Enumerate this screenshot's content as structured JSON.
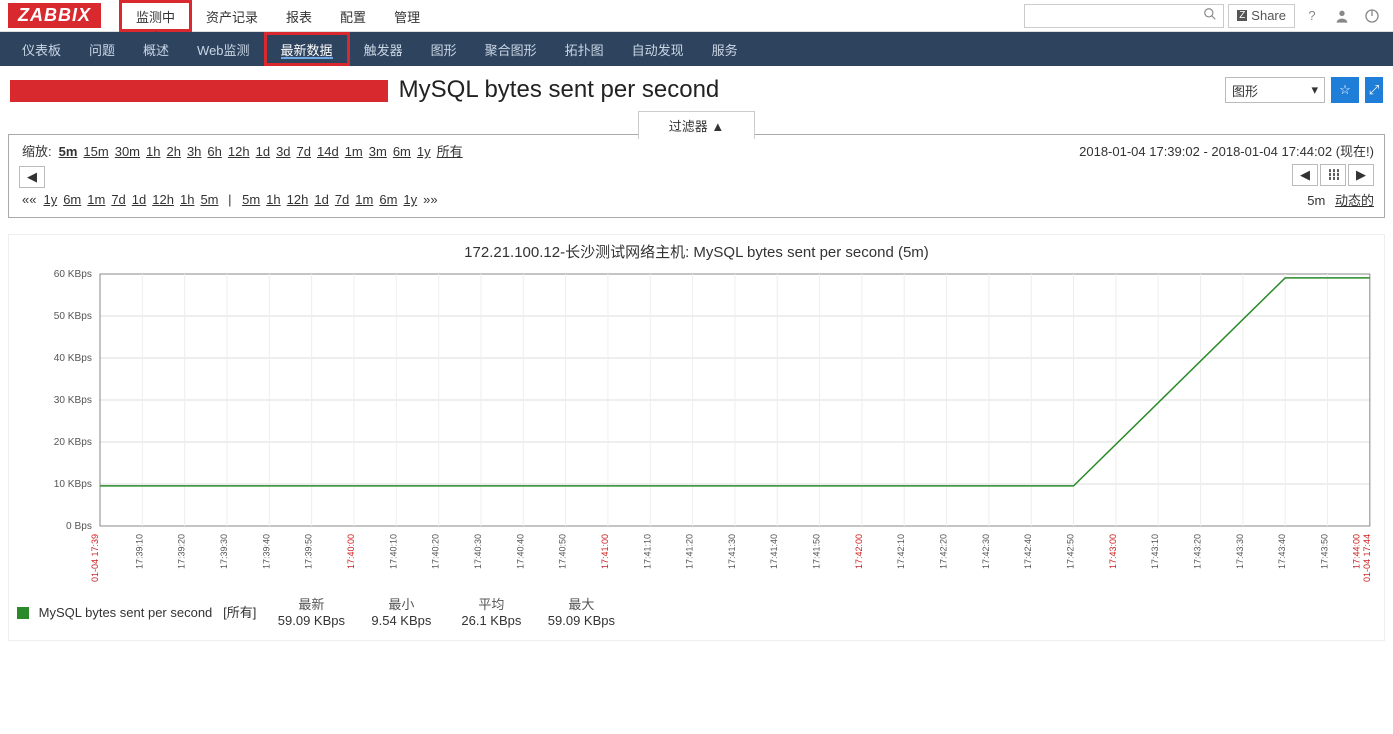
{
  "logo": "ZABBIX",
  "topnav": {
    "items": [
      "监测中",
      "资产记录",
      "报表",
      "配置",
      "管理"
    ],
    "active_index": 0,
    "highlight_index": 0
  },
  "topright": {
    "share": "Share"
  },
  "subnav": {
    "items": [
      "仪表板",
      "问题",
      "概述",
      "Web监测",
      "最新数据",
      "触发器",
      "图形",
      "聚合图形",
      "拓扑图",
      "自动发现",
      "服务"
    ],
    "active_index": 4,
    "highlight_index": 4
  },
  "page_title_suffix": " MySQL bytes sent per second",
  "view_select": "图形",
  "filter_toggle": "过滤器 ▲",
  "zoom": {
    "label": "缩放:",
    "options": [
      "5m",
      "15m",
      "30m",
      "1h",
      "2h",
      "3h",
      "6h",
      "12h",
      "1d",
      "3d",
      "7d",
      "14d",
      "1m",
      "3m",
      "6m",
      "1y",
      "所有"
    ],
    "active": "5m"
  },
  "time_range": "2018-01-04 17:39:02 - 2018-01-04 17:44:02 (现在!)",
  "hist_left": {
    "prefix": "««",
    "groups": [
      [
        "1y",
        "6m",
        "1m",
        "7d",
        "1d",
        "12h",
        "1h",
        "5m"
      ],
      [
        "5m",
        "1h",
        "12h",
        "1d",
        "7d",
        "1m",
        "6m",
        "1y"
      ]
    ],
    "suffix": "»»"
  },
  "right_meta": {
    "val": "5m",
    "mode": "动态的"
  },
  "chart_data": {
    "type": "line",
    "title": "172.21.100.12-长沙测试网络主机: MySQL bytes sent per second (5m)",
    "ylabel_unit": "Bps",
    "y_ticks": [
      0,
      10,
      20,
      30,
      40,
      50,
      60
    ],
    "y_tick_labels": [
      "0 Bps",
      "10 KBps",
      "20 KBps",
      "30 KBps",
      "40 KBps",
      "50 KBps",
      "60 KBps"
    ],
    "x_start_label": "01-04 17:39",
    "x_end_label_top": "17:44:00",
    "x_end_label_bottom": "01-04 17:44",
    "x_ticks": [
      "17:39:10",
      "17:39:20",
      "17:39:30",
      "17:39:40",
      "17:39:50",
      "17:40:00",
      "17:40:10",
      "17:40:20",
      "17:40:30",
      "17:40:40",
      "17:40:50",
      "17:41:00",
      "17:41:10",
      "17:41:20",
      "17:41:30",
      "17:41:40",
      "17:41:50",
      "17:42:00",
      "17:42:10",
      "17:42:20",
      "17:42:30",
      "17:42:40",
      "17:42:50",
      "17:43:00",
      "17:43:10",
      "17:43:20",
      "17:43:30",
      "17:43:40",
      "17:43:50"
    ],
    "x_tick_red": [
      5,
      11,
      17,
      23
    ],
    "series": [
      {
        "name": "MySQL bytes sent per second",
        "color": "#2a8a2a",
        "suffix": "[所有]",
        "data": [
          [
            0,
            9.54
          ],
          [
            230,
            9.54
          ],
          [
            280,
            59.09
          ],
          [
            300,
            59.09
          ]
        ],
        "x_domain": [
          0,
          300
        ],
        "y_domain": [
          0,
          60
        ]
      }
    ],
    "stats": {
      "latest_label": "最新",
      "min_label": "最小",
      "avg_label": "平均",
      "max_label": "最大",
      "latest": "59.09 KBps",
      "min": "9.54 KBps",
      "avg": "26.1 KBps",
      "max": "59.09 KBps"
    }
  }
}
